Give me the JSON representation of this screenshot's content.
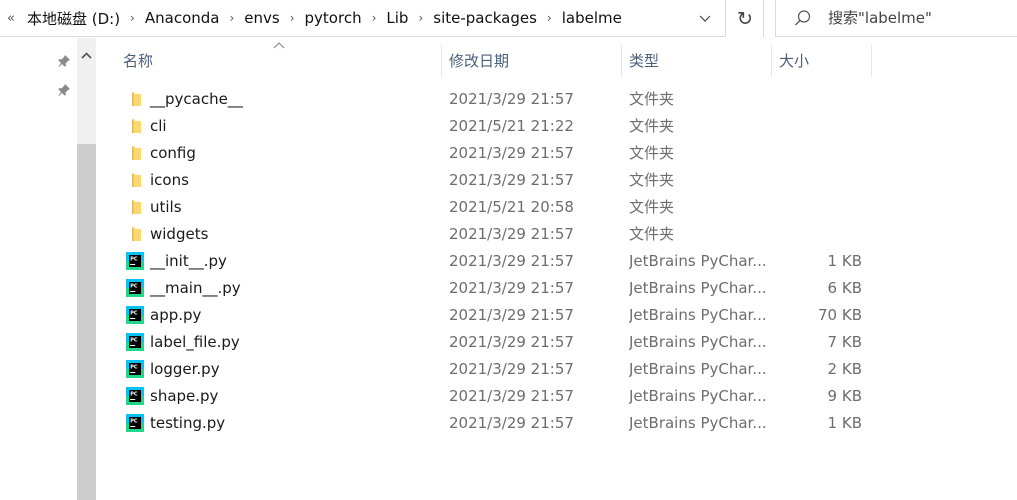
{
  "address_bar": {
    "overflow_glyph": "«",
    "crumbs": [
      "本地磁盘 (D:)",
      "Anaconda",
      "envs",
      "pytorch",
      "Lib",
      "site-packages",
      "labelme"
    ],
    "separator_glyph": "›",
    "dropdown_glyph": "⌄"
  },
  "refresh": {
    "glyph": "↻",
    "icon": "refresh-icon"
  },
  "search": {
    "placeholder": "搜索\"labelme\"",
    "icon": "search-icon"
  },
  "nav_pane": {
    "pins": [
      "pin-icon",
      "pin-icon"
    ]
  },
  "columns": {
    "name": "名称",
    "date": "修改日期",
    "type": "类型",
    "size": "大小"
  },
  "files": [
    {
      "name": "__pycache__",
      "date": "2021/3/29 21:57",
      "type": "文件夹",
      "size": "",
      "icon": "folder-icon"
    },
    {
      "name": "cli",
      "date": "2021/5/21 21:22",
      "type": "文件夹",
      "size": "",
      "icon": "folder-icon"
    },
    {
      "name": "config",
      "date": "2021/3/29 21:57",
      "type": "文件夹",
      "size": "",
      "icon": "folder-icon"
    },
    {
      "name": "icons",
      "date": "2021/3/29 21:57",
      "type": "文件夹",
      "size": "",
      "icon": "folder-icon"
    },
    {
      "name": "utils",
      "date": "2021/5/21 20:58",
      "type": "文件夹",
      "size": "",
      "icon": "folder-icon"
    },
    {
      "name": "widgets",
      "date": "2021/3/29 21:57",
      "type": "文件夹",
      "size": "",
      "icon": "folder-icon"
    },
    {
      "name": "__init__.py",
      "date": "2021/3/29 21:57",
      "type": "JetBrains PyChar...",
      "size": "1 KB",
      "icon": "pycharm-file-icon"
    },
    {
      "name": "__main__.py",
      "date": "2021/3/29 21:57",
      "type": "JetBrains PyChar...",
      "size": "6 KB",
      "icon": "pycharm-file-icon"
    },
    {
      "name": "app.py",
      "date": "2021/3/29 21:57",
      "type": "JetBrains PyChar...",
      "size": "70 KB",
      "icon": "pycharm-file-icon"
    },
    {
      "name": "label_file.py",
      "date": "2021/3/29 21:57",
      "type": "JetBrains PyChar...",
      "size": "7 KB",
      "icon": "pycharm-file-icon"
    },
    {
      "name": "logger.py",
      "date": "2021/3/29 21:57",
      "type": "JetBrains PyChar...",
      "size": "2 KB",
      "icon": "pycharm-file-icon"
    },
    {
      "name": "shape.py",
      "date": "2021/3/29 21:57",
      "type": "JetBrains PyChar...",
      "size": "9 KB",
      "icon": "pycharm-file-icon"
    },
    {
      "name": "testing.py",
      "date": "2021/3/29 21:57",
      "type": "JetBrains PyChar...",
      "size": "1 KB",
      "icon": "pycharm-file-icon"
    }
  ],
  "colors": {
    "header_text": "#4c607a",
    "folder_yellow": "#f8d775",
    "pycharm_green": "#21d789",
    "pycharm_blue": "#07c3f2"
  }
}
